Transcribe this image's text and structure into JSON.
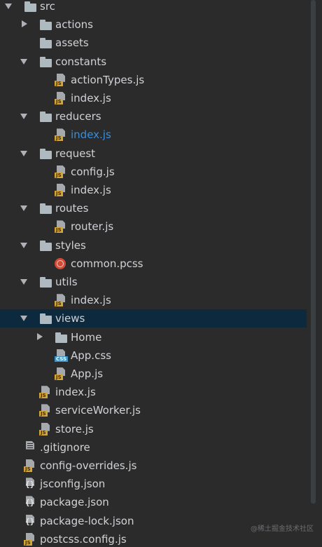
{
  "tree": [
    {
      "label": "src",
      "kind": "folder",
      "level": 0,
      "expanded": true
    },
    {
      "label": "actions",
      "kind": "folder",
      "level": 1,
      "expanded": false
    },
    {
      "label": "assets",
      "kind": "folder",
      "level": 1,
      "expanded": null
    },
    {
      "label": "constants",
      "kind": "folder",
      "level": 1,
      "expanded": true
    },
    {
      "label": "actionTypes.js",
      "kind": "js",
      "level": 2
    },
    {
      "label": "index.js",
      "kind": "js",
      "level": 2
    },
    {
      "label": "reducers",
      "kind": "folder",
      "level": 1,
      "expanded": true
    },
    {
      "label": "index.js",
      "kind": "js",
      "level": 2,
      "highlighted": true
    },
    {
      "label": "request",
      "kind": "folder",
      "level": 1,
      "expanded": true
    },
    {
      "label": "config.js",
      "kind": "js",
      "level": 2
    },
    {
      "label": "index.js",
      "kind": "js",
      "level": 2
    },
    {
      "label": "routes",
      "kind": "folder",
      "level": 1,
      "expanded": true
    },
    {
      "label": "router.js",
      "kind": "js",
      "level": 2
    },
    {
      "label": "styles",
      "kind": "folder",
      "level": 1,
      "expanded": true
    },
    {
      "label": "common.pcss",
      "kind": "pcss",
      "level": 2
    },
    {
      "label": "utils",
      "kind": "folder",
      "level": 1,
      "expanded": true
    },
    {
      "label": "index.js",
      "kind": "js",
      "level": 2
    },
    {
      "label": "views",
      "kind": "folder",
      "level": 1,
      "expanded": true,
      "selected": true
    },
    {
      "label": "Home",
      "kind": "folder",
      "level": 2,
      "expanded": false
    },
    {
      "label": "App.css",
      "kind": "css",
      "level": 2
    },
    {
      "label": "App.js",
      "kind": "js",
      "level": 2
    },
    {
      "label": "index.js",
      "kind": "js",
      "level": 1
    },
    {
      "label": "serviceWorker.js",
      "kind": "js",
      "level": 1
    },
    {
      "label": "store.js",
      "kind": "js",
      "level": 1
    },
    {
      "label": ".gitignore",
      "kind": "text",
      "level": 0
    },
    {
      "label": "config-overrides.js",
      "kind": "js",
      "level": 0
    },
    {
      "label": "jsconfig.json",
      "kind": "json",
      "level": 0
    },
    {
      "label": "package.json",
      "kind": "json",
      "level": 0
    },
    {
      "label": "package-lock.json",
      "kind": "json",
      "level": 0
    },
    {
      "label": "postcss.config.js",
      "kind": "js",
      "level": 0
    }
  ],
  "badges": {
    "js": "JS",
    "css": "CSS",
    "json": "{}"
  },
  "colors": {
    "background": "#2b2b2b",
    "selection": "#0d293e",
    "highlight_text": "#3d8ed6",
    "folder": "#aeb9c0",
    "js_badge": "#d4a637",
    "css_badge": "#3a96c9",
    "pcss": "#d04a36"
  },
  "watermark": "@稀土掘金技术社区"
}
